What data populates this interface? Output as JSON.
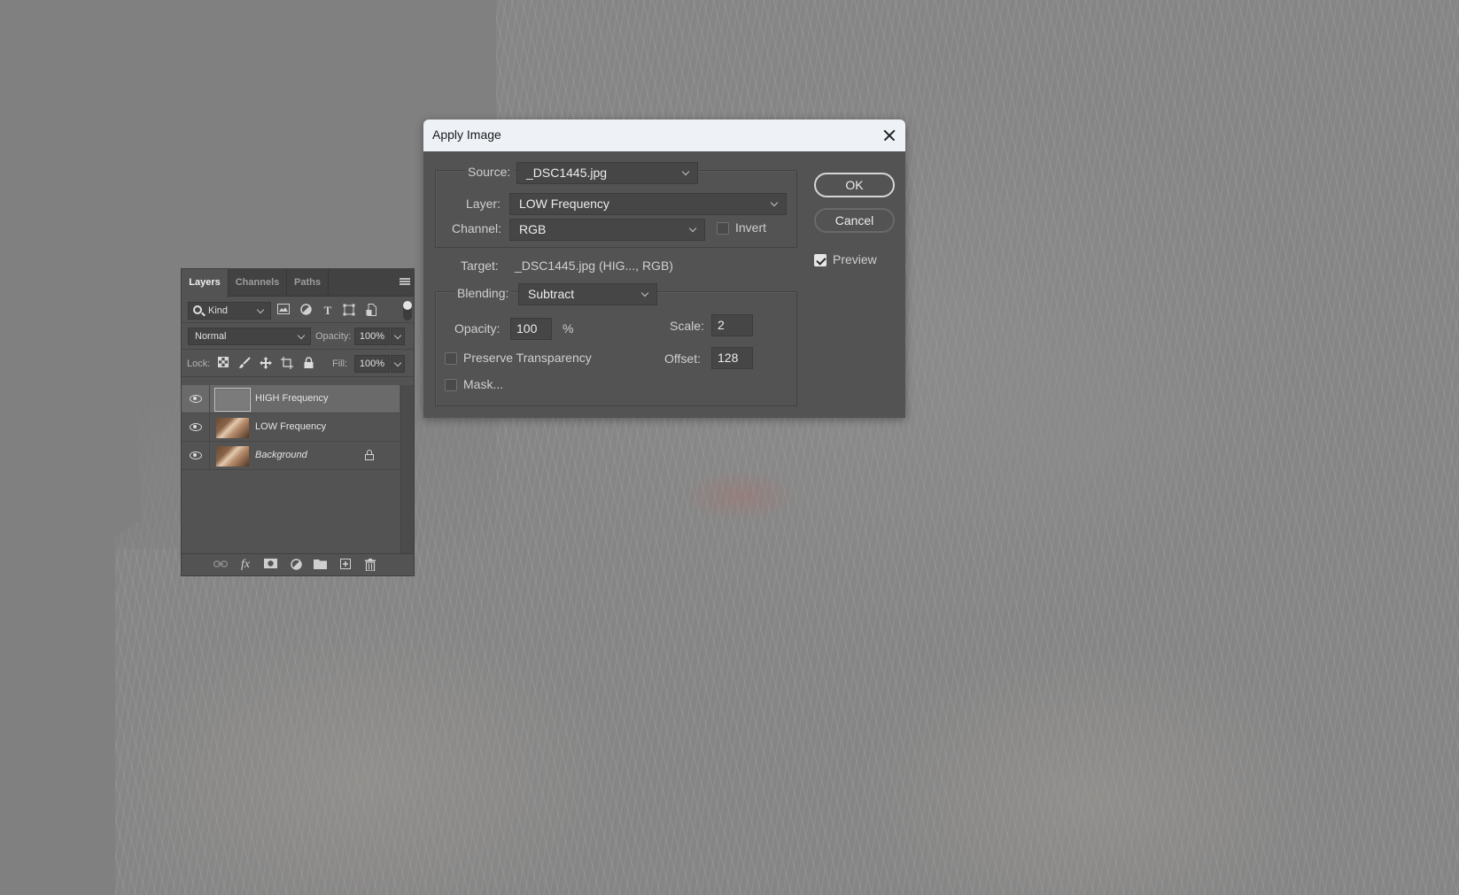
{
  "canvas": {
    "description": "high-frequency layer preview of portrait"
  },
  "layers_panel": {
    "tabs": [
      {
        "label": "Layers",
        "active": true
      },
      {
        "label": "Channels",
        "active": false
      },
      {
        "label": "Paths",
        "active": false
      }
    ],
    "filter": {
      "kind_label": "Kind",
      "filter_icons": [
        "pixel-layer-filter-icon",
        "adjustment-layer-filter-icon",
        "type-layer-filter-icon",
        "shape-layer-filter-icon",
        "smart-object-filter-icon"
      ],
      "filter_toggle_on": true
    },
    "blend_mode": "Normal",
    "opacity_label": "Opacity:",
    "opacity_value": "100%",
    "lock_label": "Lock:",
    "fill_label": "Fill:",
    "fill_value": "100%",
    "layers": [
      {
        "name": "HIGH Frequency",
        "visible": true,
        "selected": true,
        "locked": false,
        "italic": false,
        "thumbnail": "gray"
      },
      {
        "name": "LOW Frequency",
        "visible": true,
        "selected": false,
        "locked": false,
        "italic": false,
        "thumbnail": "photo"
      },
      {
        "name": "Background",
        "visible": true,
        "selected": false,
        "locked": true,
        "italic": true,
        "thumbnail": "photo"
      }
    ],
    "footer_icons": [
      "link-layers-icon",
      "fx-icon",
      "add-mask-icon",
      "adjustment-layer-icon",
      "new-group-icon",
      "new-layer-icon",
      "delete-layer-icon"
    ]
  },
  "dialog": {
    "title": "Apply Image",
    "source_label": "Source:",
    "source_value": "_DSC1445.jpg",
    "layer_label": "Layer:",
    "layer_value": "LOW Frequency",
    "channel_label": "Channel:",
    "channel_value": "RGB",
    "invert_label": "Invert",
    "invert_checked": false,
    "target_label": "Target:",
    "target_value": "_DSC1445.jpg (HIG..., RGB)",
    "blending_label": "Blending:",
    "blending_value": "Subtract",
    "opacity_label": "Opacity:",
    "opacity_value": "100",
    "opacity_unit": "%",
    "scale_label": "Scale:",
    "scale_value": "2",
    "offset_label": "Offset:",
    "offset_value": "128",
    "preserve_transparency_label": "Preserve Transparency",
    "preserve_transparency_checked": false,
    "mask_label": "Mask...",
    "mask_checked": false,
    "ok_label": "OK",
    "cancel_label": "Cancel",
    "preview_label": "Preview",
    "preview_checked": true
  }
}
